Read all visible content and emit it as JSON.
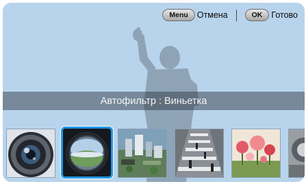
{
  "topbar": {
    "menu_key": "Menu",
    "menu_label": "Отмена",
    "ok_key": "OK",
    "ok_label": "Готово"
  },
  "caption": "Автофильтр : Виньетка",
  "filters": [
    {
      "icon": "fisheye-lens-icon",
      "selected": false
    },
    {
      "icon": "vignette-lens-icon",
      "selected": true
    },
    {
      "icon": "miniature-city-icon",
      "selected": false
    },
    {
      "icon": "crosswalk-photo-icon",
      "selected": false
    },
    {
      "icon": "flowers-photo-icon",
      "selected": false
    },
    {
      "icon": "partial-thumbnail-icon",
      "selected": false
    }
  ],
  "colors": {
    "background": "#b8d4ec",
    "selection": "#1e96e6",
    "silhouette": "#8a9eb1"
  }
}
